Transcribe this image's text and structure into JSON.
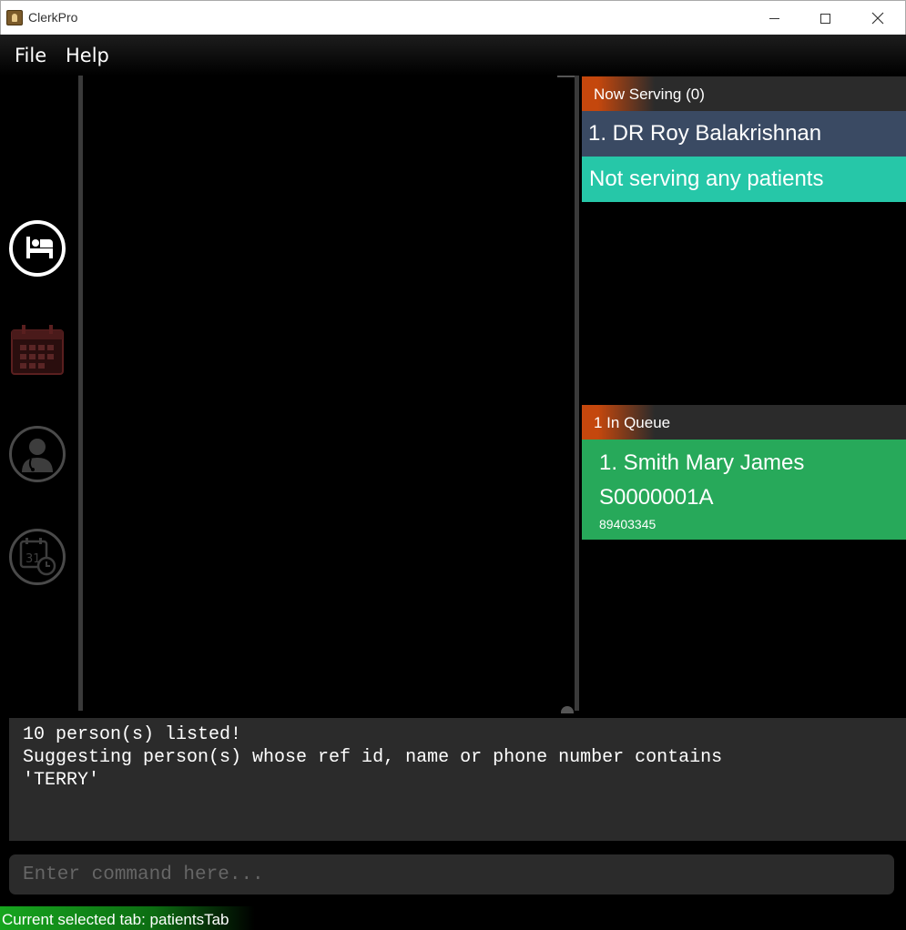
{
  "window": {
    "title": "ClerkPro",
    "minimize_icon": "minimize-icon",
    "maximize_icon": "maximize-icon",
    "close_icon": "close-icon"
  },
  "menu": {
    "items": [
      "File",
      "Help"
    ]
  },
  "sidebar": {
    "tabs": [
      {
        "icon": "bed-icon",
        "active": true
      },
      {
        "icon": "calendar-icon",
        "active": false
      },
      {
        "icon": "doctor-icon",
        "active": false
      },
      {
        "icon": "calendar-clock-icon",
        "active": false
      }
    ]
  },
  "now_serving": {
    "header": "Now Serving (0)",
    "doctor": "1. DR Roy Balakrishnan",
    "status": "Not serving any patients"
  },
  "queue": {
    "header": "1 In Queue",
    "patients": [
      {
        "name": "1.  Smith Mary James",
        "ref_id": "S0000001A",
        "phone": "89403345"
      }
    ]
  },
  "result": {
    "lines": [
      "10 person(s) listed!",
      "Suggesting person(s) whose ref id, name or phone number contains",
      "'TERRY'"
    ]
  },
  "command": {
    "placeholder": "Enter command here...",
    "value": ""
  },
  "status_bar": {
    "text": "Current selected tab: patientsTab"
  },
  "colors": {
    "doctor_row": "#3a4a63",
    "status_row": "#26c7a8",
    "queue_card": "#27a95a",
    "header_accent": "#c4470d"
  }
}
